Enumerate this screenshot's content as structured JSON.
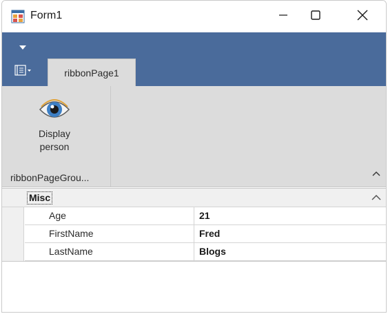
{
  "window": {
    "title": "Form1",
    "controls": {
      "minimize": "minimize-icon",
      "maximize": "maximize-icon",
      "close": "close-icon"
    }
  },
  "ribbon": {
    "background_color": "#4a6b9b",
    "tabs": [
      {
        "label": "ribbonPage1",
        "active": true
      }
    ],
    "groups": [
      {
        "label": "ribbonPageGrou...",
        "buttons": [
          {
            "label": "Display person",
            "icon": "eye-icon"
          }
        ]
      }
    ]
  },
  "property_grid": {
    "category": "Misc",
    "properties": [
      {
        "name": "Age",
        "value": "21"
      },
      {
        "name": "FirstName",
        "value": "Fred"
      },
      {
        "name": "LastName",
        "value": "Blogs"
      }
    ]
  }
}
